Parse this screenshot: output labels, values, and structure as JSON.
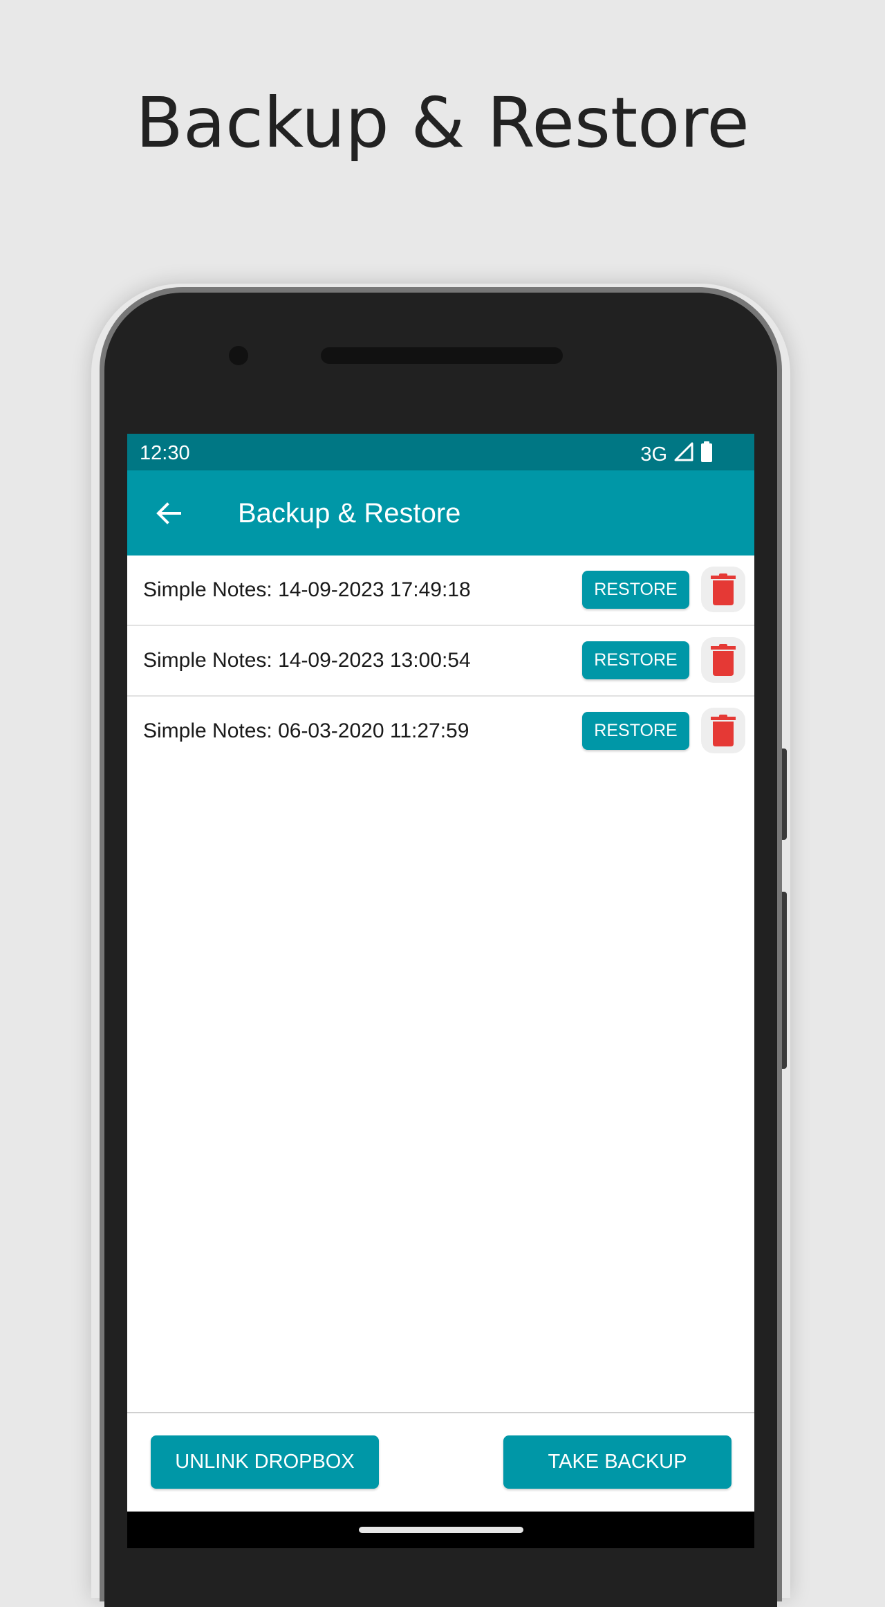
{
  "hero": {
    "title": "Backup & Restore"
  },
  "status_bar": {
    "time": "12:30",
    "network": "3G",
    "signal_icon": "signal-icon",
    "battery_icon": "battery-icon"
  },
  "app_bar": {
    "back_icon": "arrow-left-icon",
    "title": "Backup & Restore",
    "color": "#0097a7",
    "status_color": "#007784"
  },
  "backups": [
    {
      "label": "Simple Notes: 14-09-2023 17:49:18",
      "restore_label": "RESTORE",
      "delete_icon": "trash-icon"
    },
    {
      "label": "Simple Notes: 14-09-2023 13:00:54",
      "restore_label": "RESTORE",
      "delete_icon": "trash-icon"
    },
    {
      "label": "Simple Notes: 06-03-2020 11:27:59",
      "restore_label": "RESTORE",
      "delete_icon": "trash-icon"
    }
  ],
  "actions": {
    "unlink_label": "UNLINK DROPBOX",
    "backup_label": "TAKE BACKUP"
  },
  "colors": {
    "accent": "#0097a7",
    "delete": "#e53935"
  }
}
